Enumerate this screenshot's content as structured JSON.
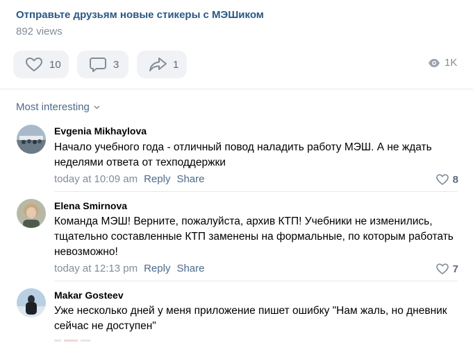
{
  "post": {
    "title": "Отправьте друзьям новые стикеры с МЭШиком",
    "views_text": "892 views"
  },
  "actions": {
    "likes": "10",
    "comments": "3",
    "shares": "1",
    "views": "1K"
  },
  "sort": {
    "label": "Most interesting"
  },
  "comments": [
    {
      "author": "Evgenia Mikhaylova",
      "text": "Начало учебного года - отличный повод наладить работу МЭШ. А не ждать неделями ответа от техподдержки",
      "time": "today at 10:09 am",
      "reply": "Reply",
      "share": "Share",
      "likes": "8"
    },
    {
      "author": "Elena Smirnova",
      "text": "Команда МЭШ! Верните, пожалуйста, архив КТП! Учебники не изменились, тщательно составленные КТП заменены на формальные, по которым работать невозможно!",
      "time": "today at 12:13 pm",
      "reply": "Reply",
      "share": "Share",
      "likes": "7"
    },
    {
      "author": "Makar Gosteev",
      "text": "Уже несколько дней у меня приложение пишет ошибку \"Нам жаль, но дневник сейчас не доступен\""
    }
  ],
  "colors": {
    "link": "#2a5885",
    "secondary": "#818c99",
    "accent": "#4d6a8a",
    "pill_bg": "#f0f2f5"
  }
}
